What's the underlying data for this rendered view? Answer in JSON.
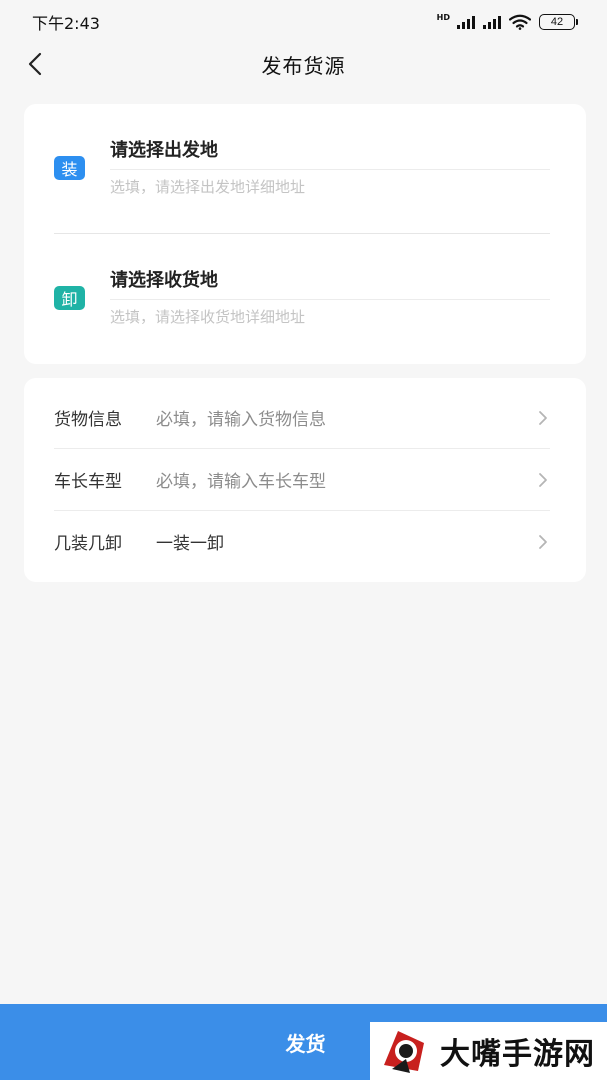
{
  "status_bar": {
    "time": "下午2:43",
    "network_label": "HD",
    "battery": "42"
  },
  "nav": {
    "title": "发布货源",
    "back_icon": "chevron-left-icon"
  },
  "locations": {
    "origin": {
      "badge": "装",
      "badge_color": "#2d8ff0",
      "title": "请选择出发地",
      "detail_placeholder": "选填，请选择出发地详细地址"
    },
    "destination": {
      "badge": "卸",
      "badge_color": "#1fb3a6",
      "title": "请选择收货地",
      "detail_placeholder": "选填，请选择收货地详细地址"
    }
  },
  "info_rows": [
    {
      "label": "货物信息",
      "value": "必填，请输入货物信息"
    },
    {
      "label": "车长车型",
      "value": "必填，请输入车长车型"
    },
    {
      "label": "几装几卸",
      "value": "一装一卸"
    }
  ],
  "submit": {
    "label": "发货",
    "color": "#3b8ee8"
  },
  "watermark": {
    "text": "大嘴手游网"
  }
}
